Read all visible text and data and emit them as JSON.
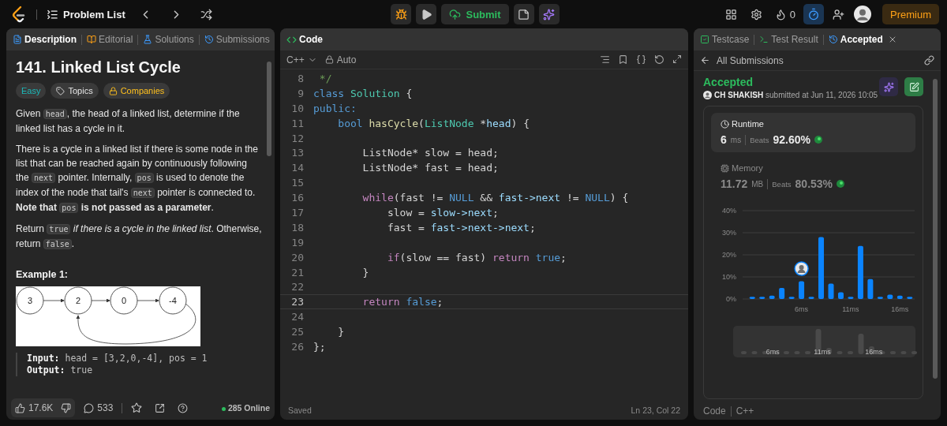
{
  "top_bar": {
    "problem_list": "Problem List",
    "submit": "Submit",
    "streak": "0",
    "timer_active": true,
    "premium": "Premium"
  },
  "left_panel": {
    "tabs": [
      {
        "label": "Description",
        "selected": true
      },
      {
        "label": "Editorial",
        "selected": false
      },
      {
        "label": "Solutions",
        "selected": false
      },
      {
        "label": "Submissions",
        "selected": false
      }
    ],
    "title": "141. Linked List Cycle",
    "tags": [
      {
        "label": "Easy",
        "kind": "difficulty"
      },
      {
        "label": "Topics",
        "kind": "topics"
      },
      {
        "label": "Companies",
        "kind": "companies"
      }
    ],
    "paragraphs": [
      [
        {
          "kind": "text",
          "text": "Given "
        },
        {
          "kind": "code",
          "text": "head"
        },
        {
          "kind": "text",
          "text": ", the head of a linked list, determine if the linked list has a cycle in it."
        }
      ],
      [
        {
          "kind": "text",
          "text": "There is a cycle in a linked list if there is some node in the list that can be reached again by continuously following the "
        },
        {
          "kind": "code",
          "text": "next"
        },
        {
          "kind": "text",
          "text": " pointer. Internally, "
        },
        {
          "kind": "code",
          "text": "pos"
        },
        {
          "kind": "text",
          "text": " is used to denote the index of the node that tail's "
        },
        {
          "kind": "code",
          "text": "next"
        },
        {
          "kind": "text",
          "text": " pointer is connected to. "
        },
        {
          "kind": "bold",
          "text": "Note that "
        },
        {
          "kind": "code",
          "text": "pos"
        },
        {
          "kind": "bold",
          "text": " is not passed as a parameter"
        },
        {
          "kind": "text",
          "text": "."
        }
      ],
      [
        {
          "kind": "text",
          "text": "Return "
        },
        {
          "kind": "code",
          "text": "true"
        },
        {
          "kind": "italic",
          "text": " if there is a cycle in the linked list"
        },
        {
          "kind": "text",
          "text": ". Otherwise, return "
        },
        {
          "kind": "code",
          "text": "false"
        },
        {
          "kind": "text",
          "text": "."
        }
      ]
    ],
    "example": {
      "title": "Example 1:",
      "nodes": [
        "3",
        "2",
        "0",
        "-4"
      ],
      "io": [
        {
          "label": "Input:",
          "value": "head = [3,2,0,-4], pos = 1"
        },
        {
          "label": "Output:",
          "value": "true"
        }
      ]
    },
    "footer": {
      "likes": "17.6K",
      "comments": "533",
      "online": "285 Online"
    }
  },
  "code_panel": {
    "tab": {
      "label": "Code",
      "selected": true
    },
    "language": "C++",
    "mode": "Auto",
    "lines": [
      {
        "number": "8",
        "current": false,
        "tokens": [
          {
            "kind": "comment",
            "text": " */"
          }
        ]
      },
      {
        "number": "9",
        "current": false,
        "tokens": [
          {
            "kind": "kw",
            "text": "class"
          },
          {
            "kind": "type",
            "text": " Solution"
          },
          {
            "kind": "plain",
            "text": " {"
          }
        ]
      },
      {
        "number": "10",
        "current": false,
        "tokens": [
          {
            "kind": "kw",
            "text": "public:"
          }
        ]
      },
      {
        "number": "11",
        "current": false,
        "tokens": [
          {
            "kind": "kw",
            "text": "    bool"
          },
          {
            "kind": "fn",
            "text": " hasCycle"
          },
          {
            "kind": "plain",
            "text": "("
          },
          {
            "kind": "type",
            "text": "ListNode"
          },
          {
            "kind": "plain",
            "text": " *"
          },
          {
            "kind": "var",
            "text": "head"
          },
          {
            "kind": "plain",
            "text": ") {"
          }
        ]
      },
      {
        "number": "12",
        "current": false
      },
      {
        "number": "13",
        "current": false,
        "tokens": [
          {
            "kind": "plain",
            "text": "        ListNode* slow = head;"
          }
        ]
      },
      {
        "number": "14",
        "current": false,
        "tokens": [
          {
            "kind": "plain",
            "text": "        ListNode* fast = head;"
          }
        ]
      },
      {
        "number": "15",
        "current": false
      },
      {
        "number": "16",
        "current": false,
        "tokens": [
          {
            "kind": "ctrl",
            "text": "        while"
          },
          {
            "kind": "plain",
            "text": "(fast != "
          },
          {
            "kind": "kw",
            "text": "NULL"
          },
          {
            "kind": "plain",
            "text": " && "
          },
          {
            "kind": "var",
            "text": "fast->next"
          },
          {
            "kind": "plain",
            "text": " != "
          },
          {
            "kind": "kw",
            "text": "NULL"
          },
          {
            "kind": "plain",
            "text": ") {"
          }
        ]
      },
      {
        "number": "17",
        "current": false,
        "tokens": [
          {
            "kind": "plain",
            "text": "            slow = "
          },
          {
            "kind": "var",
            "text": "slow->next"
          },
          {
            "kind": "plain",
            "text": ";"
          }
        ]
      },
      {
        "number": "18",
        "current": false,
        "tokens": [
          {
            "kind": "plain",
            "text": "            fast = "
          },
          {
            "kind": "var",
            "text": "fast->next->next"
          },
          {
            "kind": "plain",
            "text": ";"
          }
        ]
      },
      {
        "number": "19",
        "current": false
      },
      {
        "number": "20",
        "current": false,
        "tokens": [
          {
            "kind": "ctrl",
            "text": "            if"
          },
          {
            "kind": "plain",
            "text": "(slow == fast) "
          },
          {
            "kind": "ctrl",
            "text": "return"
          },
          {
            "kind": "kw",
            "text": " true"
          },
          {
            "kind": "plain",
            "text": ";"
          }
        ]
      },
      {
        "number": "21",
        "current": false,
        "tokens": [
          {
            "kind": "plain",
            "text": "        }"
          }
        ]
      },
      {
        "number": "22",
        "current": false
      },
      {
        "number": "23",
        "current": true,
        "tokens": [
          {
            "kind": "ctrl",
            "text": "        return"
          },
          {
            "kind": "kw",
            "text": " false"
          },
          {
            "kind": "plain",
            "text": ";"
          }
        ]
      },
      {
        "number": "24",
        "current": false
      },
      {
        "number": "25",
        "current": false,
        "tokens": [
          {
            "kind": "plain",
            "text": "    }"
          }
        ]
      },
      {
        "number": "26",
        "current": false,
        "tokens": [
          {
            "kind": "plain",
            "text": "};"
          }
        ]
      }
    ],
    "status": "Saved",
    "cursor": "Ln 23, Col 22"
  },
  "result_panel": {
    "tabs": [
      {
        "label": "Testcase",
        "selected": false
      },
      {
        "label": "Test Result",
        "selected": false
      },
      {
        "label": "Accepted",
        "selected": true
      }
    ],
    "back": "All Submissions",
    "verdict": "Accepted",
    "user": "CH SHAKISH",
    "submitted": "submitted at Jun 11, 2026 10:05",
    "stats": [
      {
        "kind": "runtime",
        "title": "Runtime",
        "value": "6",
        "unit": "ms",
        "beats_label": "Beats",
        "beats": "92.60%",
        "selected": true
      },
      {
        "kind": "memory",
        "title": "Memory",
        "value": "11.72",
        "unit": "MB",
        "beats_label": "Beats",
        "beats": "80.53%",
        "selected": false
      }
    ],
    "chart_data": {
      "type": "bar",
      "categories": [
        null,
        null,
        null,
        null,
        null,
        "6ms",
        null,
        null,
        null,
        null,
        "11ms",
        null,
        null,
        null,
        null,
        "16ms",
        null
      ],
      "series": [
        {
          "color": "#0a84ff",
          "values": [
            1,
            1,
            1.5,
            5,
            1,
            8,
            1,
            28,
            7,
            3,
            1,
            24,
            9,
            1,
            2,
            1.5,
            1
          ]
        }
      ],
      "ylim": [
        0,
        40
      ],
      "yticks": [
        {
          "value": 0,
          "label": "0%"
        },
        {
          "value": 10,
          "label": "10%"
        },
        {
          "value": 20,
          "label": "20%"
        },
        {
          "value": 30,
          "label": "30%"
        },
        {
          "value": 40,
          "label": "40%"
        }
      ],
      "grid": true,
      "annotations": [
        {
          "x": "6ms"
        }
      ]
    },
    "overview_labels": [
      "6ms",
      "11ms",
      "16ms"
    ],
    "code_label": "Code",
    "code_language": "C++"
  }
}
